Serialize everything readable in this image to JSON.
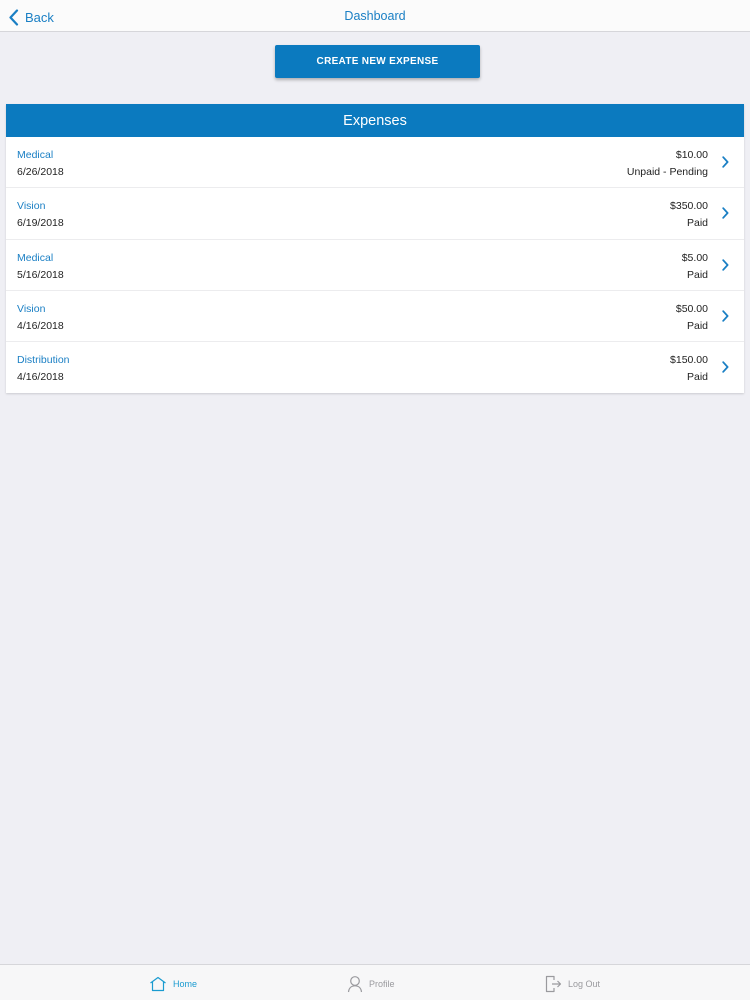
{
  "nav": {
    "back_label": "Back",
    "title": "Dashboard"
  },
  "actions": {
    "create_label": "CREATE NEW EXPENSE"
  },
  "expenses": {
    "header": "Expenses",
    "items": [
      {
        "category": "Medical",
        "date": "6/26/2018",
        "amount": "$10.00",
        "status": "Unpaid - Pending"
      },
      {
        "category": "Vision",
        "date": "6/19/2018",
        "amount": "$350.00",
        "status": "Paid"
      },
      {
        "category": "Medical",
        "date": "5/16/2018",
        "amount": "$5.00",
        "status": "Paid"
      },
      {
        "category": "Vision",
        "date": "4/16/2018",
        "amount": "$50.00",
        "status": "Paid"
      },
      {
        "category": "Distribution",
        "date": "4/16/2018",
        "amount": "$150.00",
        "status": "Paid"
      }
    ]
  },
  "tabbar": {
    "home_label": "Home",
    "profile_label": "Profile",
    "logout_label": "Log Out",
    "active": "Home"
  },
  "colors": {
    "accent": "#0b7abf",
    "link": "#1a7fc4",
    "background": "#efeff4",
    "inactive_tab": "#9a9a9e"
  }
}
